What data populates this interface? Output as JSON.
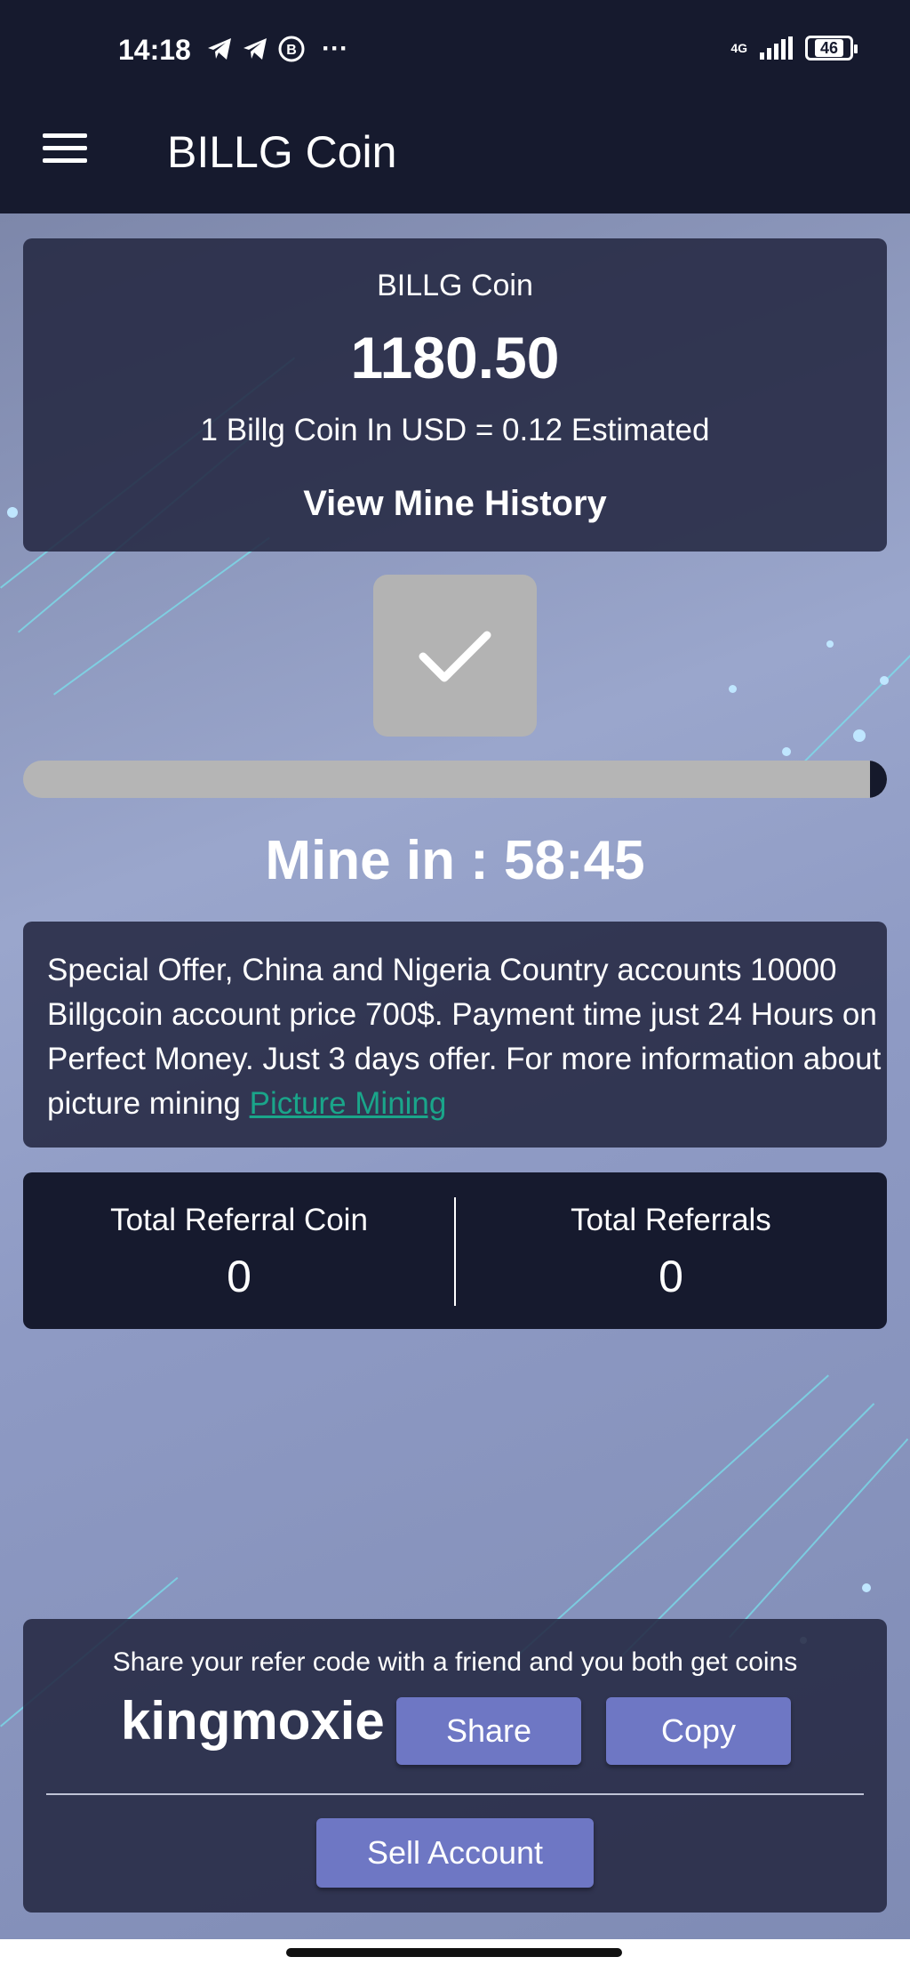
{
  "status_bar": {
    "time": "14:18",
    "icons": [
      "telegram-icon",
      "telegram-icon",
      "bitcoin-icon",
      "more-dots-icon"
    ],
    "network": "4G",
    "battery": "46"
  },
  "app_bar": {
    "title": "BILLG Coin"
  },
  "balance": {
    "title": "BILLG Coin",
    "amount": "1180.50",
    "rate": "1 Billg Coin In USD = 0.12 Estimated",
    "history_link": "View Mine History"
  },
  "mining": {
    "progress_fraction": 0.98,
    "timer": "Mine in : 58:45"
  },
  "offer": {
    "text": "Special Offer, China and Nigeria Country accounts 10000 Billgcoin account price 700$. Payment time just 24 Hours on Perfect Money. Just 3 days offer. For more information about picture mining ",
    "link": "Picture Mining"
  },
  "referrals": {
    "coin_label": "Total Referral Coin",
    "coin_value": "0",
    "count_label": "Total Referrals",
    "count_value": "0"
  },
  "share": {
    "text": "Share your refer code with a friend and you both get coins",
    "code": "kingmoxie",
    "share_label": "Share",
    "copy_label": "Copy",
    "sell_label": "Sell Account"
  },
  "colors": {
    "header_bg": "#161a2e",
    "button": "#6e77c4",
    "link": "#1aa58a"
  }
}
